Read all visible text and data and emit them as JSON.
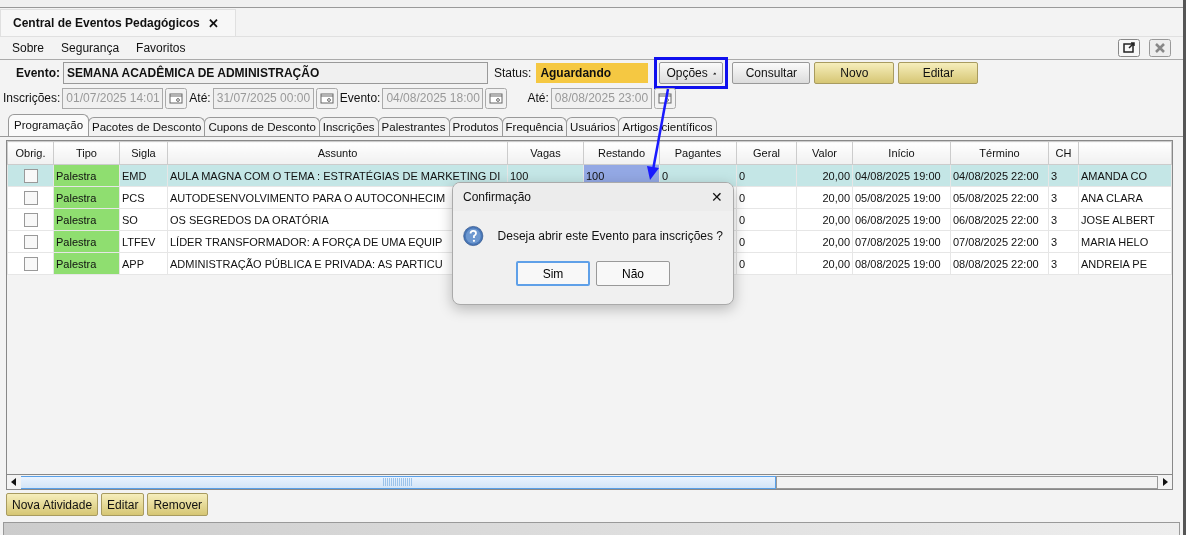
{
  "document_tab": {
    "title": "Central de Eventos Pedagógicos",
    "close": "✕"
  },
  "menu": [
    "Sobre",
    "Segurança",
    "Favoritos"
  ],
  "evento": {
    "label": "Evento:",
    "value": "SEMANA ACADÊMICA DE ADMINISTRAÇÃO"
  },
  "status": {
    "label": "Status:",
    "value": "Aguardando",
    "color": "#f5c842"
  },
  "toolbar": [
    {
      "label": "Opções",
      "kind": "menu"
    },
    {
      "label": "Consultar",
      "kind": "plain"
    },
    {
      "label": "Novo",
      "kind": "gold"
    },
    {
      "label": "Editar",
      "kind": "gold"
    }
  ],
  "dates": [
    {
      "label": "Inscrições:",
      "value": "01/07/2025 14:01",
      "disabled": true
    },
    {
      "label": "Até:",
      "value": "31/07/2025 00:00",
      "disabled": true
    },
    {
      "label": "Evento:",
      "value": "04/08/2025 18:00",
      "disabled": true
    },
    {
      "label": "Até:",
      "value": "08/08/2025 23:00",
      "disabled": true
    }
  ],
  "tabs": [
    {
      "label": "Programação",
      "selected": true
    },
    {
      "label": "Pacotes de Desconto",
      "selected": false
    },
    {
      "label": "Cupons de Desconto",
      "selected": false
    },
    {
      "label": "Inscrições",
      "selected": false
    },
    {
      "label": "Palestrantes",
      "selected": false
    },
    {
      "label": "Produtos",
      "selected": false
    },
    {
      "label": "Frequência",
      "selected": false
    },
    {
      "label": "Usuários",
      "selected": false
    },
    {
      "label": "Artigos científicos",
      "selected": false
    }
  ],
  "table": {
    "columns": [
      "Obrig.",
      "Tipo",
      "Sigla",
      "Assunto",
      "Vagas",
      "Restando",
      "Pagantes",
      "Geral",
      "Valor",
      "Início",
      "Término",
      "CH"
    ],
    "rows": [
      {
        "selected": true,
        "obrig": false,
        "tipo": "Palestra",
        "sigla": "EMD",
        "assunto": "AULA MAGNA COM O TEMA : ESTRATÉGIAS DE MARKETING DI",
        "vagas": "100",
        "restando": "100",
        "pagantes": "0",
        "geral": "0",
        "valor": "20,00",
        "inicio": "04/08/2025 19:00",
        "termino": "04/08/2025 22:00",
        "ch": "3",
        "column_13": "AMANDA CO"
      },
      {
        "selected": false,
        "obrig": false,
        "tipo": "Palestra",
        "sigla": "PCS",
        "assunto": "AUTODESENVOLVIMENTO PARA O AUTOCONHECIM",
        "geral": "0",
        "valor": "20,00",
        "inicio": "05/08/2025 19:00",
        "termino": "05/08/2025 22:00",
        "ch": "3",
        "column_13": "ANA CLARA"
      },
      {
        "selected": false,
        "obrig": false,
        "tipo": "Palestra",
        "sigla": "SO",
        "assunto": "OS SEGREDOS DA ORATÓRIA",
        "geral": "0",
        "valor": "20,00",
        "inicio": "06/08/2025 19:00",
        "termino": "06/08/2025 22:00",
        "ch": "3",
        "column_13": "JOSE ALBERT"
      },
      {
        "selected": false,
        "obrig": false,
        "tipo": "Palestra",
        "sigla": "LTFEV",
        "assunto": "LÍDER TRANSFORMADOR: A FORÇA DE UMA EQUIP",
        "geral": "0",
        "valor": "20,00",
        "inicio": "07/08/2025 19:00",
        "termino": "07/08/2025 22:00",
        "ch": "3",
        "column_13": "MARIA HELO"
      },
      {
        "selected": false,
        "obrig": false,
        "tipo": "Palestra",
        "sigla": "APP",
        "assunto": "ADMINISTRAÇÃO PÚBLICA E PRIVADA: AS PARTICU",
        "geral": "0",
        "valor": "20,00",
        "inicio": "08/08/2025 19:00",
        "termino": "08/08/2025 22:00",
        "ch": "3",
        "column_13": "ANDREIA PE"
      }
    ]
  },
  "bottom_buttons": [
    "Nova Atividade",
    "Editar",
    "Remover"
  ],
  "dialog": {
    "title": "Confirmação",
    "close": "✕",
    "message": "Deseja abrir este Evento para inscrições ?",
    "buttons": [
      {
        "label": "Sim",
        "selected": true
      },
      {
        "label": "Não",
        "selected": false
      }
    ]
  }
}
